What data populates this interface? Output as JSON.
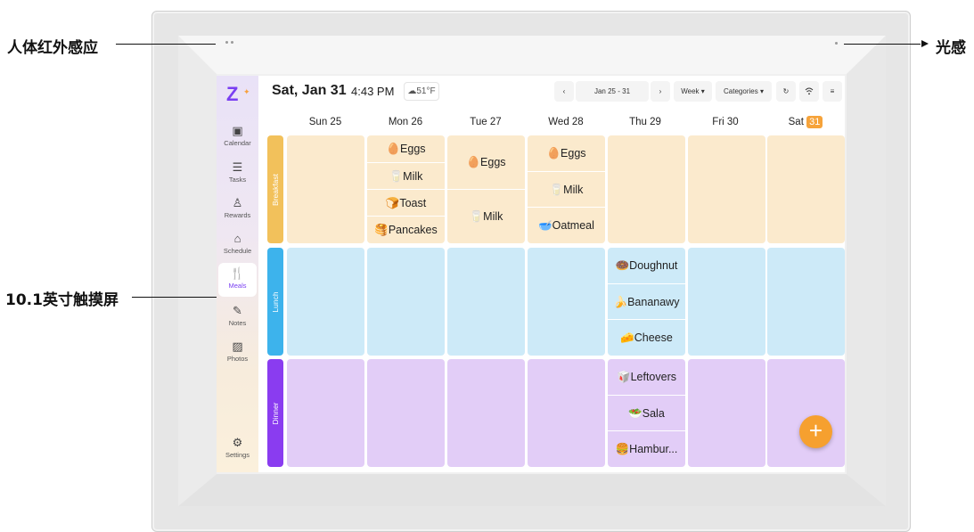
{
  "annotations": {
    "ir_sensor": "人体红外感应",
    "light_sensor": "光感",
    "screen_size": "10.1英寸触摸屏"
  },
  "header": {
    "date": "Sat, Jan 31",
    "time": "4:43 PM",
    "weather": "☁51°F",
    "prev_icon": "chevron-left",
    "range": "Jan 25 - 31",
    "next_icon": "chevron-right",
    "view": "Week ▾",
    "categories": "Categories ▾",
    "refresh_icon": "↻",
    "wifi_icon": "wifi",
    "settings_icon": "≡"
  },
  "sidebar": {
    "items": [
      {
        "label": "Calendar",
        "icon": "calendar-icon"
      },
      {
        "label": "Tasks",
        "icon": "tasks-icon"
      },
      {
        "label": "Rewards",
        "icon": "rewards-icon"
      },
      {
        "label": "Schedule",
        "icon": "schedule-icon"
      },
      {
        "label": "Meals",
        "icon": "meals-icon"
      },
      {
        "label": "Notes",
        "icon": "notes-icon"
      },
      {
        "label": "Photos",
        "icon": "photos-icon"
      },
      {
        "label": "Settings",
        "icon": "settings-icon"
      }
    ]
  },
  "days": [
    {
      "label": "Sun 25"
    },
    {
      "label": "Mon 26"
    },
    {
      "label": "Tue 27"
    },
    {
      "label": "Wed 28"
    },
    {
      "label": "Thu 29"
    },
    {
      "label": "Fri 30"
    },
    {
      "label": "Sat",
      "badge": "31"
    }
  ],
  "meals": [
    {
      "label": "Breakfast",
      "color": "#f2c15b",
      "cell_color": "#fbeacd"
    },
    {
      "label": "Lunch",
      "color": "#3db3ec",
      "cell_color": "#cdeaf8"
    },
    {
      "label": "Dinner",
      "color": "#8a3cf0",
      "cell_color": "#e2cdf7"
    }
  ],
  "entries": {
    "breakfast_mon": [
      "🥚Eggs",
      "🥛Milk",
      "🍞Toast",
      "🥞Pancakes"
    ],
    "breakfast_tue": [
      "🥚Eggs",
      "🥛Milk"
    ],
    "breakfast_wed": [
      "🥚Eggs",
      "🥛Milk",
      "🥣Oatmeal"
    ],
    "lunch_thu": [
      "🍩Doughnut",
      "🍌Bananawy",
      "🧀Cheese"
    ],
    "dinner_thu": [
      "🥡Leftovers",
      "🥗Sala",
      "🍔Hambur..."
    ]
  },
  "fab_label": "+"
}
